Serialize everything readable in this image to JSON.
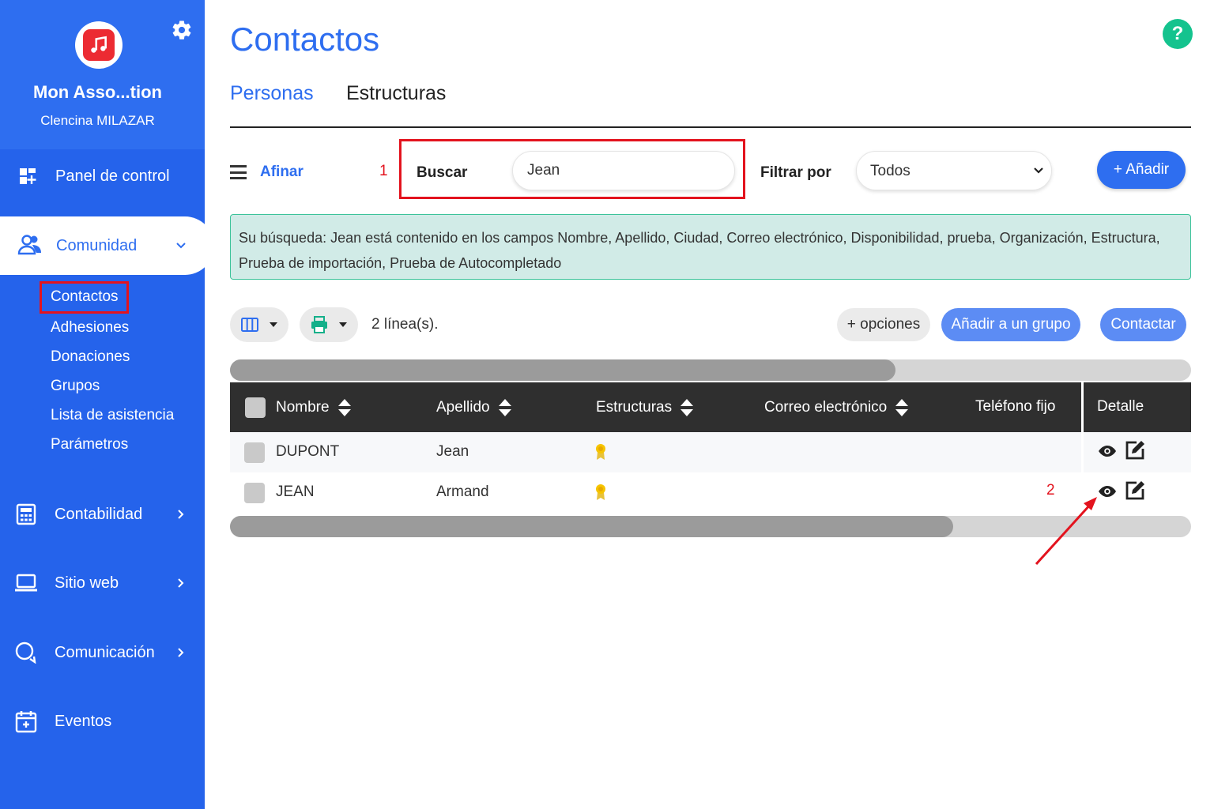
{
  "sidebar": {
    "org_name": "Mon Asso...tion",
    "user_name": "Clencina MILAZAR",
    "items": [
      {
        "label": "Panel de control",
        "icon": "dashboard-icon"
      },
      {
        "label": "Comunidad",
        "icon": "users-icon"
      },
      {
        "label": "Contabilidad",
        "icon": "calculator-icon"
      },
      {
        "label": "Sitio web",
        "icon": "laptop-icon"
      },
      {
        "label": "Comunicación",
        "icon": "chat-icon"
      },
      {
        "label": "Eventos",
        "icon": "calendar-icon"
      }
    ],
    "sub_items": [
      "Contactos",
      "Adhesiones",
      "Donaciones",
      "Grupos",
      "Lista de asistencia",
      "Parámetros"
    ]
  },
  "page": {
    "title": "Contactos",
    "help": "?",
    "tabs": [
      "Personas",
      "Estructuras"
    ]
  },
  "filters": {
    "afinar": "Afinar",
    "marker_1": "1",
    "search_label": "Buscar",
    "search_value": "Jean",
    "filter_label": "Filtrar por",
    "filter_value": "Todos",
    "add_button": "+ Añadir"
  },
  "info": {
    "text": "Su búsqueda: Jean está contenido en los campos Nombre, Apellido, Ciudad, Correo electrónico, Disponibilidad, prueba, Organización, Estructura, Prueba de importación, Prueba de Autocompletado"
  },
  "toolbar": {
    "count": "2 línea(s).",
    "options": "+ opciones",
    "add_group": "Añadir a un grupo",
    "contact": "Contactar"
  },
  "table": {
    "columns": [
      "Nombre",
      "Apellido",
      "Estructuras",
      "Correo electrónico",
      "Teléfono fijo",
      "Detalle"
    ],
    "rows": [
      {
        "nombre": "DUPONT",
        "apellido": "Jean"
      },
      {
        "nombre": "JEAN",
        "apellido": "Armand"
      }
    ],
    "marker_2": "2"
  },
  "colors": {
    "primary": "#2e6ef0",
    "sidebar": "#2563eb",
    "highlight": "#e3131e",
    "info_bg": "#d1ebe7",
    "help": "#14c38e",
    "table_header": "#2f2f2f"
  }
}
